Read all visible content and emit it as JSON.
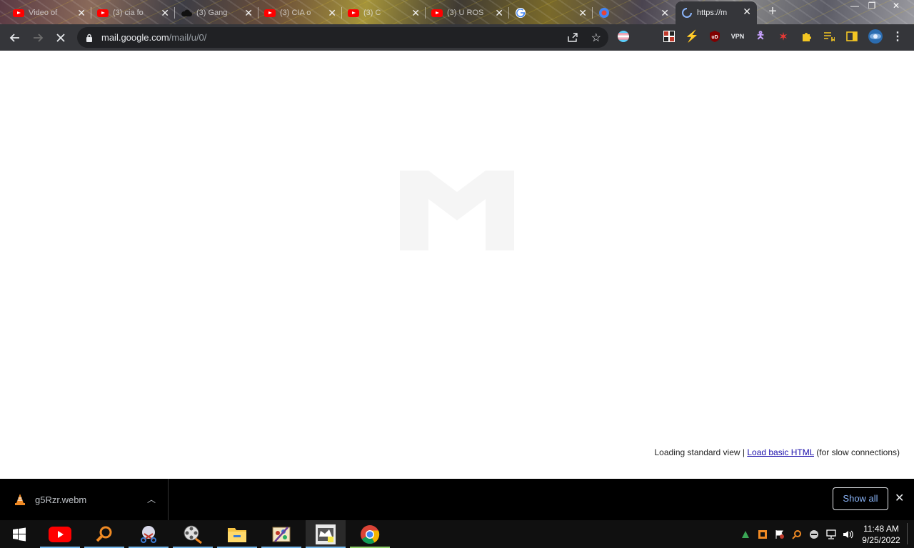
{
  "browser": {
    "tabs": [
      {
        "title": "Video of",
        "favicon": "youtube-icon"
      },
      {
        "title": "(3) cia fo",
        "favicon": "youtube-icon"
      },
      {
        "title": "(3) Gang",
        "favicon": "cloud-icon"
      },
      {
        "title": "(3) CIA o",
        "favicon": "youtube-icon"
      },
      {
        "title": "(3) C",
        "favicon": "youtube-icon"
      },
      {
        "title": "(3) U ROS",
        "favicon": "youtube-icon"
      },
      {
        "title": "",
        "favicon": "google-icon"
      },
      {
        "title": "",
        "favicon": "google-account-icon"
      },
      {
        "title": "https://m",
        "favicon": "loading-spinner-icon",
        "active": true
      }
    ],
    "url": {
      "host": "mail.google.com",
      "path": "/mail/u/0/"
    },
    "extensions": [
      "pride-flag-extension-icon",
      "puzzle-grid-extension-icon",
      "runner-extension-icon",
      "ublock-extension-icon",
      "vpn-extension-icon",
      "stick-figure-extension-icon",
      "red-figure-extension-icon",
      "extensions-puzzle-icon",
      "reading-list-icon",
      "side-panel-icon",
      "profile-avatar-icon"
    ],
    "ublock_label": "uD",
    "vpn_label": "VPN"
  },
  "page": {
    "loading_prefix": "Loading standard view | ",
    "load_basic_link": "Load basic HTML",
    "loading_suffix": " (for slow connections)"
  },
  "downloads": {
    "item_name": "g5Rzr.webm",
    "show_all_label": "Show all"
  },
  "taskbar": {
    "apps": [
      "windows-start-icon",
      "youtube-app-icon",
      "search-magnifier-app-icon",
      "snipping-tool-app-icon",
      "video-editor-app-icon",
      "file-explorer-app-icon",
      "paint-app-icon",
      "media-app-icon",
      "chrome-app-icon"
    ],
    "time": "11:48 AM",
    "date": "9/25/2022"
  },
  "colors": {
    "youtube_red": "#ff0000",
    "link_blue": "#1a0dab",
    "toolbar_bg": "#35363a",
    "omnibox_bg": "#202124",
    "show_all_text": "#8ab4f8"
  }
}
